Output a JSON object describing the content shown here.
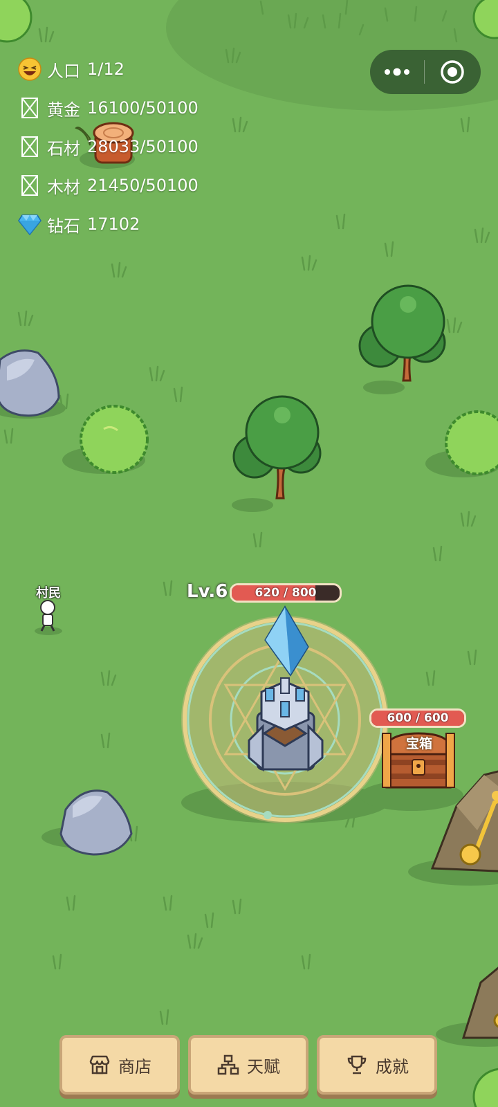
{
  "resources": [
    {
      "icon": "laughing-face-icon",
      "label": "人口",
      "value": "1/12"
    },
    {
      "icon": "missing-image-icon",
      "label": "黄金",
      "value": "16100/50100"
    },
    {
      "icon": "missing-image-icon",
      "label": "石材",
      "value": "28033/50100"
    },
    {
      "icon": "missing-image-icon",
      "label": "木材",
      "value": "21450/50100"
    },
    {
      "icon": "diamond-icon",
      "label": "钻石",
      "value": "17102"
    }
  ],
  "capsule": {
    "more_icon": "more-dots-icon",
    "close_icon": "close-circle-icon"
  },
  "villager": {
    "label": "村民"
  },
  "tower": {
    "level": "Lv.6",
    "hp_text": "620 / 800",
    "hp_fraction": 0.775
  },
  "chest": {
    "label": "宝箱",
    "hp_text": "600 / 600",
    "hp_fraction": 1.0
  },
  "menu": [
    {
      "icon": "shop-icon",
      "label": "商店"
    },
    {
      "icon": "talent-tree-icon",
      "label": "天赋"
    },
    {
      "icon": "trophy-icon",
      "label": "成就"
    }
  ],
  "colors": {
    "grass": "#73b45a",
    "hp_fill": "#e25a52",
    "button_bg": "#f4d9a6"
  }
}
